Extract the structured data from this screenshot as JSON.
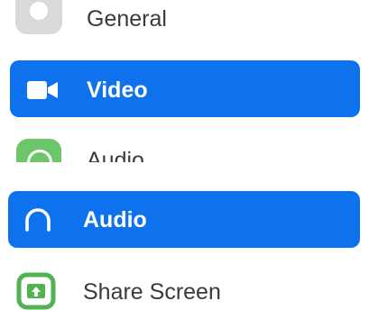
{
  "menu": {
    "items": [
      {
        "label": "General",
        "icon": "gear-icon",
        "state": "partial"
      },
      {
        "label": "Video",
        "icon": "camera-icon",
        "state": "selected"
      },
      {
        "label": "Audio",
        "icon": "audio-icon",
        "state": "partial"
      },
      {
        "label": "Audio",
        "icon": "headphones-icon",
        "state": "selected"
      },
      {
        "label": "Share Screen",
        "icon": "share-screen-icon",
        "state": "normal"
      }
    ]
  },
  "colors": {
    "accent": "#0e72ed",
    "text": "#3a3a3a",
    "general_icon": "#d9d9d9",
    "green_icon": "#6dc56c",
    "share_icon": "#52b152"
  }
}
